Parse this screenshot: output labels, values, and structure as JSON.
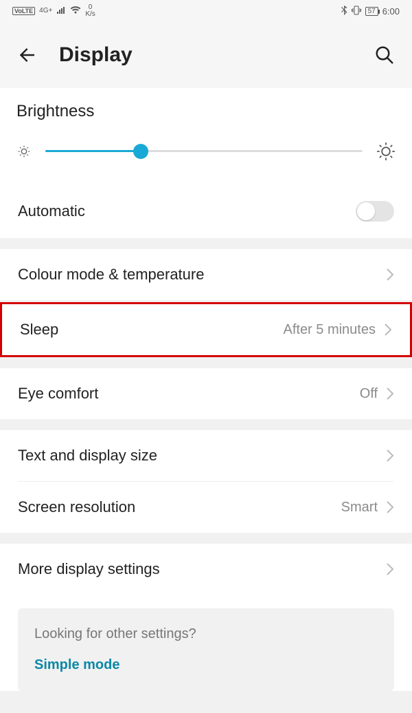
{
  "status": {
    "volte": "VoLTE",
    "net": "4G+",
    "speed_value": "0",
    "speed_unit": "K/s",
    "battery": "57",
    "time": "6:00"
  },
  "appbar": {
    "title": "Display"
  },
  "brightness": {
    "title": "Brightness",
    "automatic_label": "Automatic"
  },
  "items": {
    "colour_mode": "Colour mode & temperature",
    "sleep": "Sleep",
    "sleep_value": "After 5 minutes",
    "eye_comfort": "Eye comfort",
    "eye_comfort_value": "Off",
    "text_size": "Text and display size",
    "screen_res": "Screen resolution",
    "screen_res_value": "Smart",
    "more": "More display settings"
  },
  "card": {
    "question": "Looking for other settings?",
    "link": "Simple mode"
  }
}
